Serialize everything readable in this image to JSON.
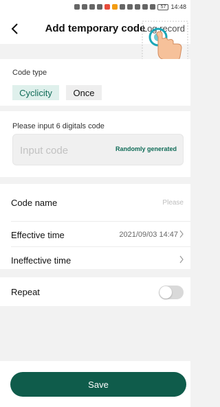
{
  "status_bar": {
    "time": "14:48",
    "battery": "57"
  },
  "header": {
    "title": "Add temporary code",
    "record": "Log record"
  },
  "code_type": {
    "label": "Code type",
    "options": [
      "Cyclicity",
      "Once"
    ],
    "selected": "Cyclicity"
  },
  "code_input": {
    "label": "Please input 6 digitals code",
    "placeholder": "Input code",
    "value": "",
    "random_label": "Randomly generated"
  },
  "fields": {
    "code_name_label": "Code name",
    "code_name_placeholder": "Please",
    "effective_label": "Effective time",
    "effective_value": "2021/09/03 14:47",
    "ineffective_label": "Ineffective time",
    "ineffective_value": ""
  },
  "repeat": {
    "label": "Repeat",
    "enabled": false
  },
  "actions": {
    "save_label": "Save"
  },
  "colors": {
    "accent": "#0f5c4b",
    "accent_light": "#dff0ec",
    "background": "#f2f2f2"
  }
}
